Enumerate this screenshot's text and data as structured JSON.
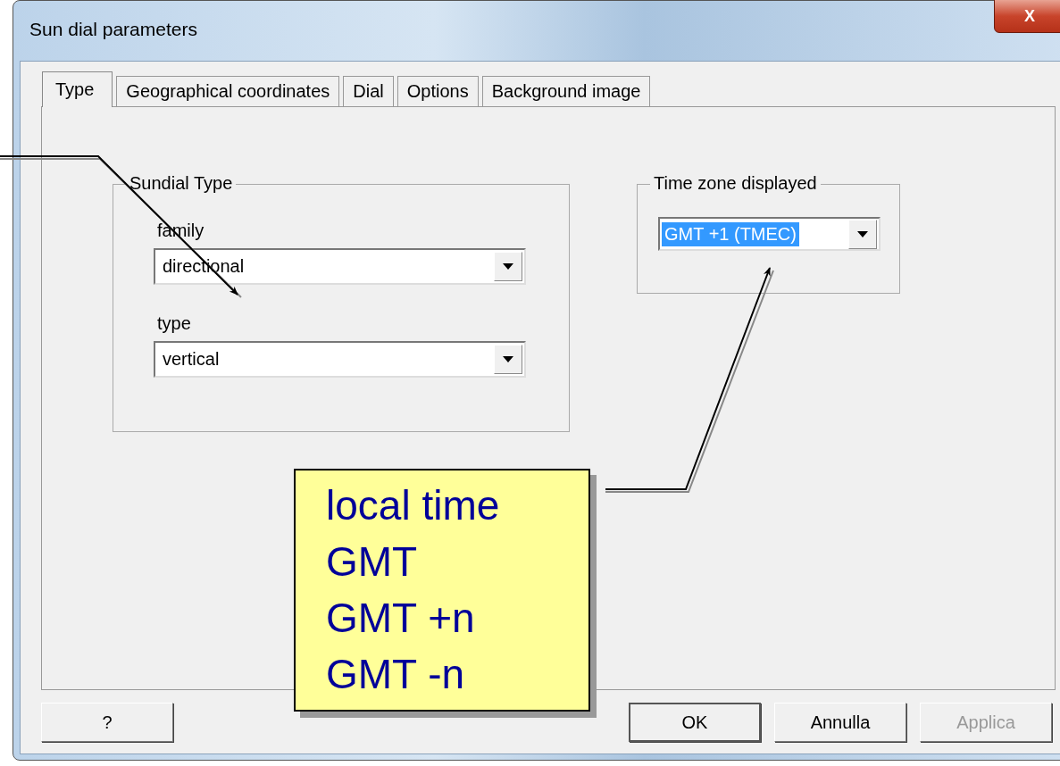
{
  "window": {
    "title": "Sun dial parameters",
    "close": "X"
  },
  "tabs": [
    {
      "label": "Type",
      "selected": true
    },
    {
      "label": "Geographical coordinates",
      "selected": false
    },
    {
      "label": "Dial",
      "selected": false
    },
    {
      "label": "Options",
      "selected": false
    },
    {
      "label": "Background image",
      "selected": false
    }
  ],
  "sundial_type": {
    "title": "Sundial Type",
    "fields": [
      {
        "label": "family",
        "value": "directional"
      },
      {
        "label": "type",
        "value": "vertical"
      }
    ]
  },
  "time_zone": {
    "title": "Time zone displayed",
    "value": "GMT +1 (TMEC)",
    "highlighted": true
  },
  "callout": {
    "lines": [
      "local time",
      "GMT",
      "GMT +n",
      "GMT -n"
    ]
  },
  "buttons": [
    {
      "label": "?",
      "disabled": false
    },
    {
      "label": "OK",
      "disabled": false
    },
    {
      "label": "Annulla",
      "disabled": false
    },
    {
      "label": "Applica",
      "disabled": true
    }
  ]
}
